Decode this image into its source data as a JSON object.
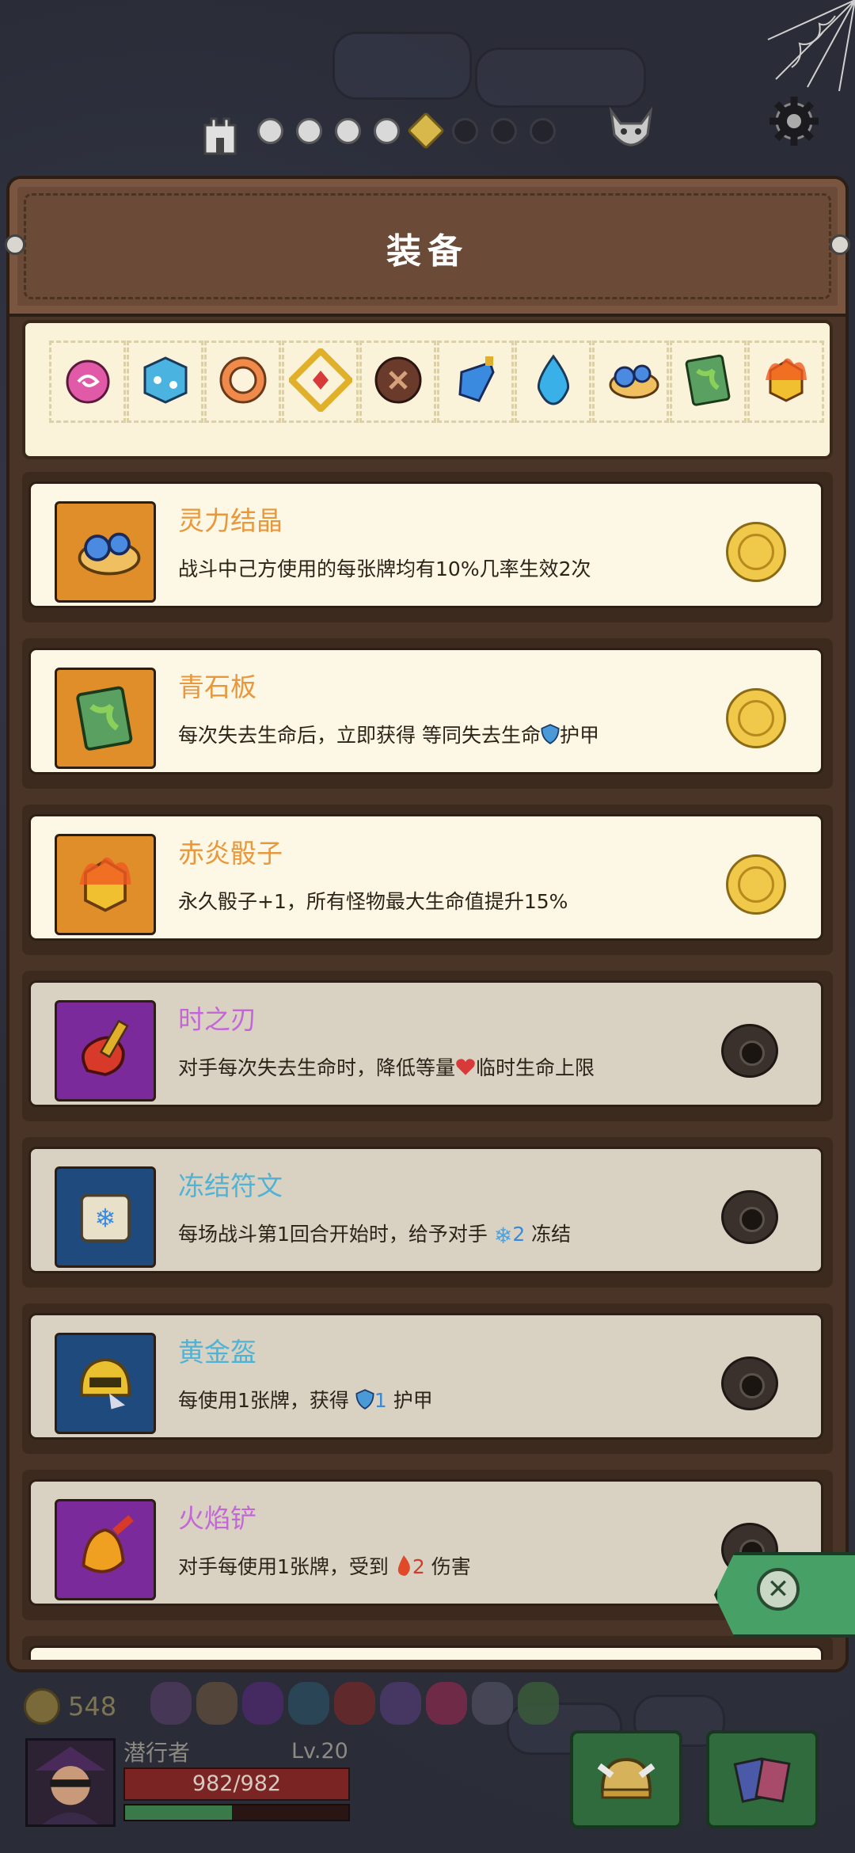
{
  "header": {
    "title": "装备"
  },
  "progress": {
    "steps": 8,
    "current_index": 4,
    "cleared": 4
  },
  "strip": {
    "items": [
      "spirit-swirl-icon",
      "ice-dice-icon",
      "ring-icon",
      "gold-chain-icon",
      "wooden-button-icon",
      "mana-potion-icon",
      "water-drop-icon",
      "spirit-crystal-icon",
      "green-slate-icon",
      "fire-dice-icon"
    ]
  },
  "equipment": [
    {
      "name": "灵力结晶",
      "desc": "战斗中己方使用的每张牌均有10%几率生效2次",
      "name_color": "#e8973a",
      "bg": "#e08e2a",
      "status": "owned",
      "icon": "spirit-crystal-icon"
    },
    {
      "name": "青石板",
      "desc_parts": [
        "每次失去生命后，立即获得 等同失去生命",
        "护甲"
      ],
      "name_color": "#e8973a",
      "bg": "#e08e2a",
      "status": "owned",
      "icon": "green-slate-icon",
      "inline_icon": "shield-icon"
    },
    {
      "name": "赤炎骰子",
      "desc": "永久骰子+1，所有怪物最大生命值提升15%",
      "name_color": "#e8973a",
      "bg": "#e08e2a",
      "status": "owned",
      "icon": "fire-dice-icon"
    },
    {
      "name": "时之刃",
      "desc_parts": [
        "对手每次失去生命时，降低等量",
        "临时生命上限"
      ],
      "name_color": "#c367d6",
      "bg": "#7a2a9a",
      "status": "locked",
      "icon": "time-blade-icon",
      "inline_icon": "heart-icon"
    },
    {
      "name": "冻结符文",
      "desc_parts": [
        "每场战斗第1回合开始时，给予对手 ",
        "2",
        " 冻结"
      ],
      "name_color": "#4fb3d6",
      "bg": "#1e4a7e",
      "status": "locked",
      "icon": "freeze-rune-icon",
      "inline_icon": "snowflake-icon"
    },
    {
      "name": "黄金盔",
      "desc_parts": [
        "每使用1张牌，获得 ",
        "1",
        " 护甲"
      ],
      "name_color": "#4fb3d6",
      "bg": "#1e4a7e",
      "status": "locked",
      "icon": "golden-helmet-icon",
      "inline_icon": "shield-icon"
    },
    {
      "name": "火焰铲",
      "desc_parts": [
        "对手每使用1张牌，受到 ",
        "2",
        " 伤害"
      ],
      "name_color": "#c367d6",
      "bg": "#7a2a9a",
      "status": "locked",
      "icon": "flame-shovel-icon",
      "inline_icon": "flame-icon"
    }
  ],
  "player": {
    "gold": "548",
    "name": "潜行者",
    "level": "Lv.20",
    "hp": "982/982",
    "xp_fraction": 0.48
  },
  "colors": {
    "accent_gold": "#f0c84a",
    "panel": "#4a3427",
    "card": "#fdf7e6"
  }
}
